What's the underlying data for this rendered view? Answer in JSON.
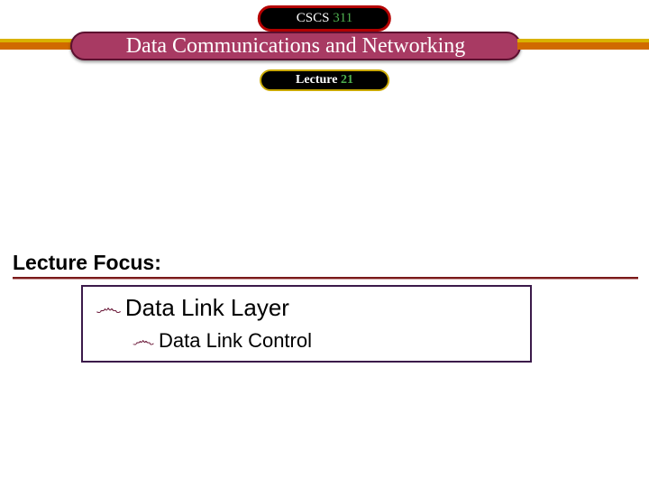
{
  "course": {
    "prefix": "CSCS",
    "number": "311"
  },
  "title": "Data Communications and Networking",
  "lecture": {
    "prefix": "Lecture",
    "number": "21"
  },
  "focus": {
    "heading": "Lecture Focus:",
    "items": [
      {
        "text": "Data Link Layer"
      },
      {
        "text": "Data Link Control"
      }
    ]
  }
}
